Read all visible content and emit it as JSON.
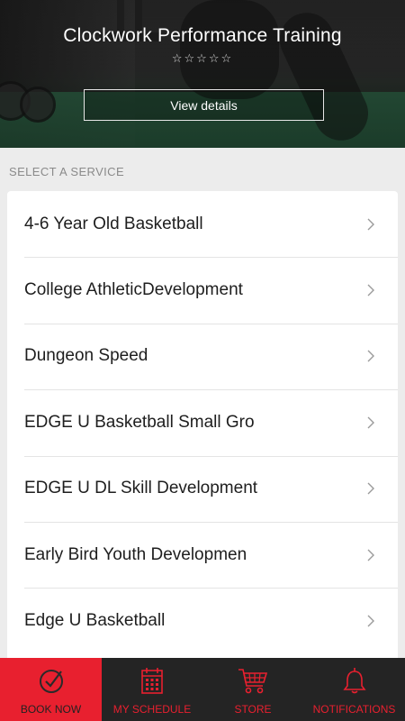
{
  "header": {
    "title": "Clockwork Performance Training",
    "rating": "☆☆☆☆☆",
    "details_button": "View details"
  },
  "section_label": "SELECT A SERVICE",
  "services": [
    {
      "label": "4-6 Year Old Basketball"
    },
    {
      "label": "College AthleticDevelopment"
    },
    {
      "label": "Dungeon Speed"
    },
    {
      "label": "EDGE U Basketball Small Gro"
    },
    {
      "label": "EDGE U DL Skill Development"
    },
    {
      "label": "Early Bird Youth Developmen"
    },
    {
      "label": "Edge U Basketball"
    }
  ],
  "nav": {
    "items": [
      {
        "label": "BOOK NOW",
        "icon": "check-circle-icon",
        "active": true
      },
      {
        "label": "MY SCHEDULE",
        "icon": "calendar-icon",
        "active": false
      },
      {
        "label": "STORE",
        "icon": "cart-icon",
        "active": false
      },
      {
        "label": "NOTIFICATIONS",
        "icon": "bell-icon",
        "active": false
      }
    ]
  },
  "colors": {
    "accent": "#e8202f",
    "nav_background": "#242424",
    "page_background": "#ececec"
  }
}
